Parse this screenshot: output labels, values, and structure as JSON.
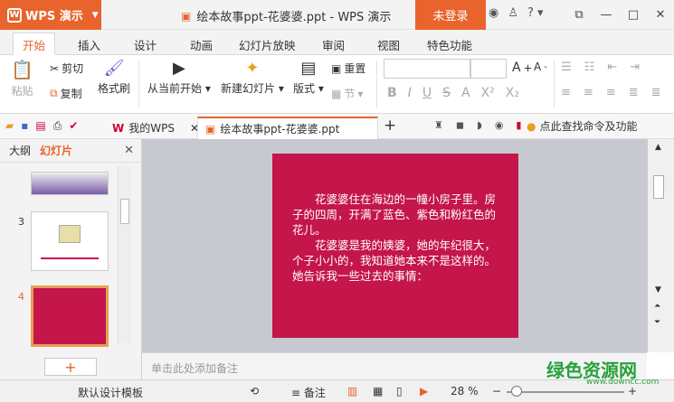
{
  "titlebar": {
    "app_menu": "WPS 演示",
    "doc_title": "绘本故事ppt-花婆婆.ppt - WPS 演示",
    "login": "未登录",
    "help": "?"
  },
  "tabs": [
    "开始",
    "插入",
    "设计",
    "动画",
    "幻灯片放映",
    "审阅",
    "视图",
    "特色功能"
  ],
  "ribbon": {
    "paste": "粘贴",
    "cut": "剪切",
    "copy": "复制",
    "format_painter": "格式刷",
    "from_current": "从当前开始",
    "new_slide": "新建幻灯片",
    "layout": "版式",
    "reset": "重置",
    "section": "节"
  },
  "quickbar": {
    "tab_mywps": "我的WPS",
    "tab_doc": "绘本故事ppt-花婆婆.ppt",
    "find": "点此查找命令及功能"
  },
  "leftpane": {
    "outline_tab": "大纲",
    "slides_tab": "幻灯片",
    "slide3_num": "3",
    "slide4_num": "4"
  },
  "slide": {
    "para1": "花婆婆住在海边的一幢小房子里。房子的四周，开满了蓝色、紫色和粉红色的花儿。",
    "para2": "花婆婆是我的姨婆，她的年纪很大，个子小小的，我知道她本来不是这样的。她告诉我一些过去的事情："
  },
  "notes": {
    "placeholder": "单击此处添加备注"
  },
  "status": {
    "design_template": "默认设计模板",
    "notes": "备注",
    "zoom": "28 %"
  },
  "watermark": {
    "text": "绿色资源网",
    "url": "www.downcc.com"
  },
  "colors": {
    "accent": "#e8642c",
    "slide_bg": "#c4164a"
  }
}
